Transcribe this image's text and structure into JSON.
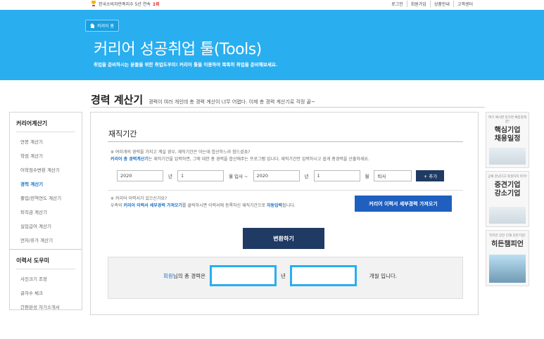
{
  "topbar": {
    "promo_text": "한국소비자만족지수 5년 연속",
    "promo_rank": "1위",
    "links": [
      "로그인",
      "회원가입",
      "상품안내",
      "고객센터"
    ]
  },
  "hero": {
    "breadcrumb": "커리어 홈",
    "title": "커리어 성공취업 툴(Tools)",
    "subtitle": "취업을 준비하시는 분들을 위한 취업도우미! 커리어 툴을 이용하여 똑똑히 취업을 준비해보세요."
  },
  "page": {
    "title": "경력 계산기",
    "description": "경력이 여러 개인데 총 경력 계산이 너무 어렵다. 이제 총 경력 계산기로 걱정 끝~"
  },
  "sidebar": {
    "section1": {
      "title": "커리어계산기",
      "items": [
        "연봉 계산기",
        "학점 계산기",
        "어학점수변환 계산기",
        "경력 계산기",
        "졸업/전역연도 계산기",
        "퇴직금 계산기",
        "실업급여 계산기",
        "연차/휴가 계산기"
      ],
      "active_index": 3
    },
    "section2": {
      "title": "이력서 도우미",
      "items": [
        "사진크기 조정",
        "글자수 체크",
        "간편완성 자기소개서"
      ]
    }
  },
  "main": {
    "section_title": "재직기간",
    "note1_line1": "※ 여러개의 경력을 가지고 계실 경우, 재직기간은 아는데 합산하느라 힘드셨죠?",
    "note1_hl": "커리어 총 경력계산기",
    "note1_line2": "는 재직기간을 입력하면, 그에 대한 총 경력을 합산해주는 프로그램 입니다. 재직기간만 입력하시고 쉽게 총경력을 산출하세요.",
    "form": {
      "start_year": "2020",
      "year_label": "년",
      "start_month": "1",
      "start_suffix": "월 입사 ~",
      "end_year": "2020",
      "end_month": "1",
      "month_label": "월",
      "status": "퇴사",
      "add_button": "+ 추가"
    },
    "note2_line1": "※ 커리어 이력서가 있으신가요?",
    "note2_pre": "우측의 ",
    "note2_hl1": "커리어 이력서 세부경력 가져오기",
    "note2_mid": "를 클릭하시면 이력서에 등록하신 재직기간으로 ",
    "note2_hl2": "자동입력",
    "note2_post": "됩니다.",
    "fetch_button": "커리어 이력서 세부경력 가져오기",
    "convert_button": "변환하기",
    "result": {
      "user": "회원",
      "pre": "님의 총 경력은",
      "year_unit": "년",
      "month_unit": "개월 입니다.",
      "years_value": "",
      "months_value": ""
    }
  },
  "ads": [
    {
      "small": "여기 채시판 있으면 채용중에 끝!",
      "big": "핵심기업\n채용일정"
    },
    {
      "small": "공채 끝났다고 좌절하지 마라!",
      "big": "중견기업\n강소기업"
    },
    {
      "small": "작지만 강한 인재 강한기업!",
      "big": "히든챔피언"
    }
  ]
}
